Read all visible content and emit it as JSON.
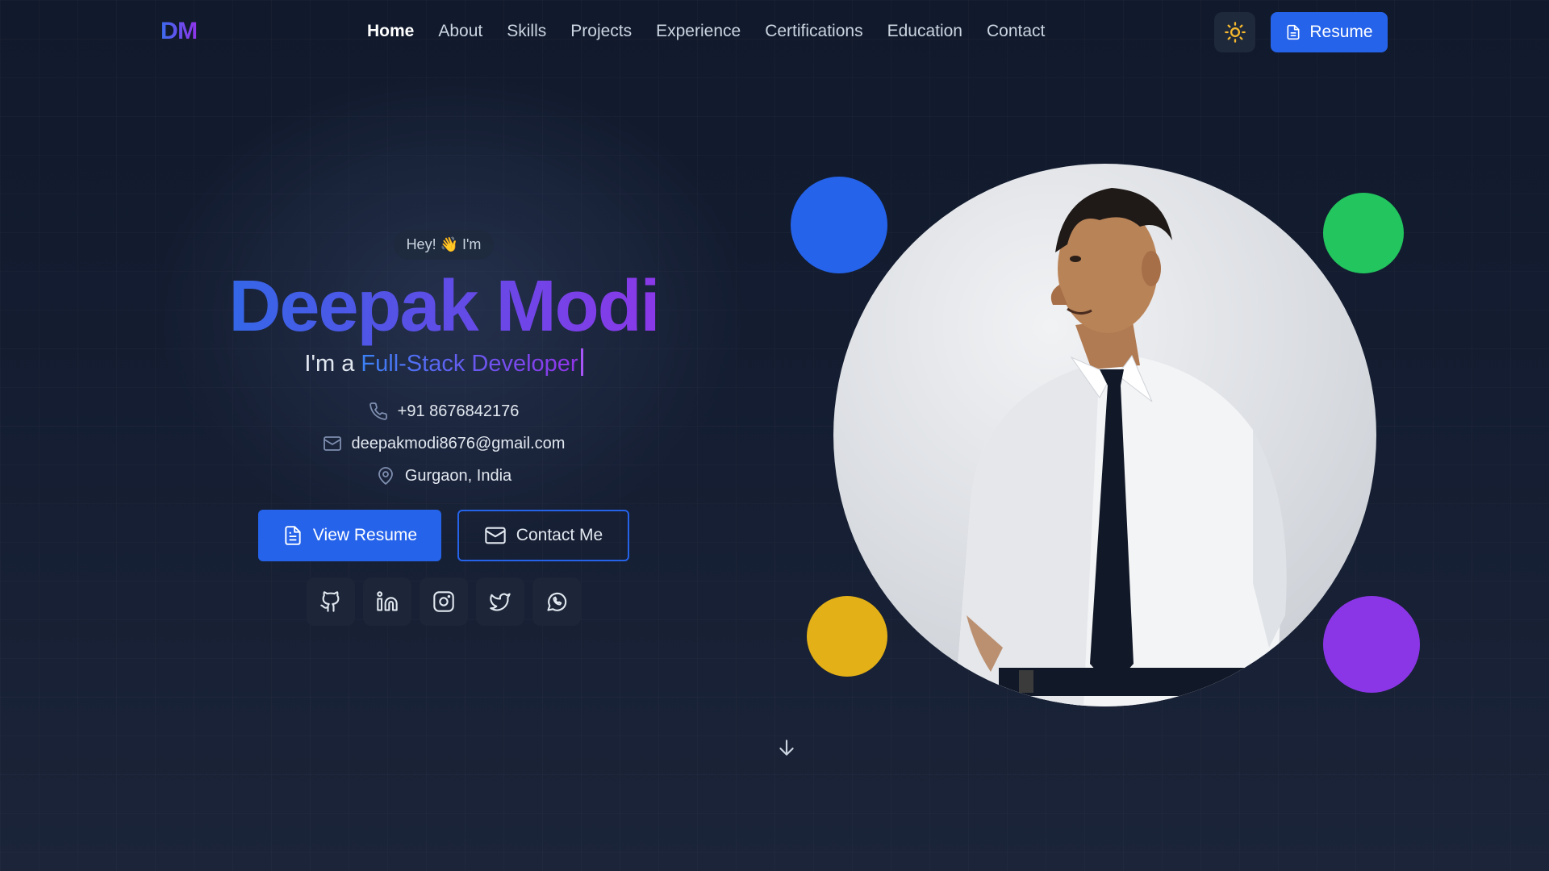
{
  "nav": {
    "logo": "DM",
    "links": [
      "Home",
      "About",
      "Skills",
      "Projects",
      "Experience",
      "Certifications",
      "Education",
      "Contact"
    ],
    "active": "Home",
    "theme_icon": "sun-icon",
    "resume_label": "Resume"
  },
  "hero": {
    "greeting": "Hey! 👋 I'm",
    "name": "Deepak Modi",
    "tagline_prefix": "I'm a ",
    "role": "Full-Stack Developer",
    "phone": "+91 8676842176",
    "email": "deepakmodi8676@gmail.com",
    "location": "Gurgaon, India",
    "view_resume_label": "View Resume",
    "contact_label": "Contact Me",
    "socials": [
      "github-icon",
      "linkedin-icon",
      "instagram-icon",
      "twitter-icon",
      "whatsapp-icon"
    ]
  },
  "colors": {
    "accent": "#2563eb",
    "gradient_end": "#9333ea",
    "dot_blue": "#2563eb",
    "dot_green": "#22c55e",
    "dot_yellow": "#e3b017",
    "dot_purple": "#8b36e6",
    "background": "#0f172a"
  }
}
